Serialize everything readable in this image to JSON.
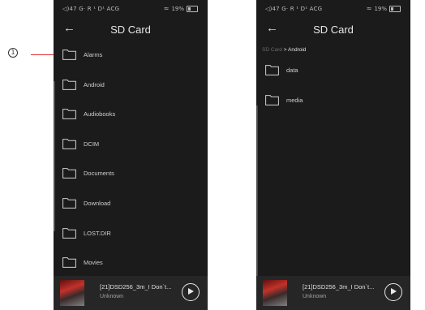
{
  "callout": {
    "number": "1"
  },
  "left_screen": {
    "status": {
      "left": "◁)47 G· R ¹ D¹ ACG",
      "battery": "19%"
    },
    "title": "SD Card",
    "folders": [
      "Alarms",
      "Android",
      "Audiobooks",
      "DCIM",
      "Documents",
      "Download",
      "LOST.DIR",
      "Movies"
    ],
    "player": {
      "track": "[21]DSD256_3m_I Don`t...",
      "artist": "Unknown"
    }
  },
  "right_screen": {
    "status": {
      "left": "◁)47 G· R ¹ D¹ ACG",
      "battery": "19%"
    },
    "title": "SD Card",
    "breadcrumb": {
      "root": "SD Card",
      "sep": " > ",
      "current": "Android"
    },
    "folders": [
      "data",
      "media"
    ],
    "player": {
      "track": "[21]DSD256_3m_I Don`t...",
      "artist": "Unknown"
    }
  },
  "colors": {
    "background": "#1b1b1b",
    "accent": "#e03030"
  },
  "icons": {
    "back": "back-arrow-icon",
    "folder": "folder-icon",
    "play": "play-icon",
    "wifi": "wifi-icon",
    "battery": "battery-icon"
  }
}
